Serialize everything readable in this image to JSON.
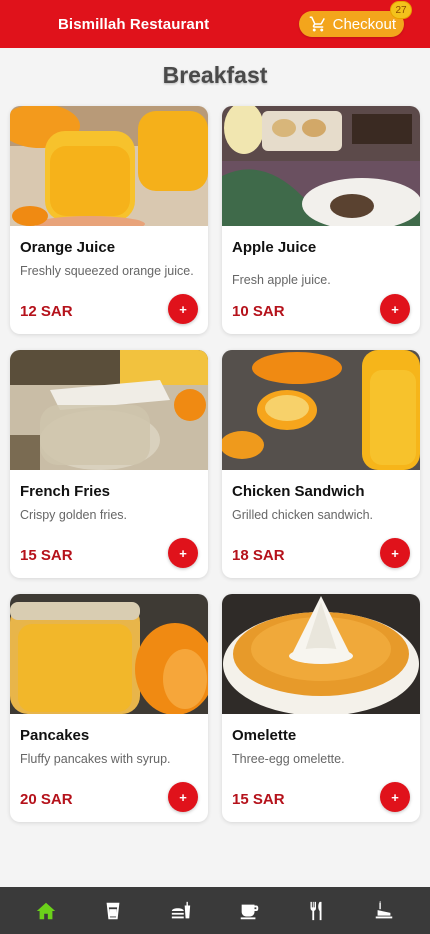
{
  "header": {
    "title": "Bismillah Restaurant",
    "checkout_label": "Checkout",
    "cart_count": "27"
  },
  "section_title": "Breakfast",
  "items": [
    {
      "name": "Orange Juice",
      "description": "Freshly squeezed orange juice.",
      "price": "12 SAR",
      "add_label": "+"
    },
    {
      "name": "Apple Juice",
      "description": "Fresh apple juice.",
      "price": "10 SAR",
      "add_label": "+"
    },
    {
      "name": "French Fries",
      "description": "Crispy golden fries.",
      "price": "15 SAR",
      "add_label": "+"
    },
    {
      "name": "Chicken Sandwich",
      "description": "Grilled chicken sandwich.",
      "price": "18 SAR",
      "add_label": "+"
    },
    {
      "name": "Pancakes",
      "description": "Fluffy pancakes with syrup.",
      "price": "20 SAR",
      "add_label": "+"
    },
    {
      "name": "Omelette",
      "description": "Three-egg omelette.",
      "price": "15 SAR",
      "add_label": "+"
    }
  ],
  "bottom_nav": [
    {
      "icon": "home-icon",
      "active": true
    },
    {
      "icon": "cup-icon",
      "active": false
    },
    {
      "icon": "burger-drink-icon",
      "active": false
    },
    {
      "icon": "coffee-icon",
      "active": false
    },
    {
      "icon": "fork-knife-icon",
      "active": false
    },
    {
      "icon": "dessert-icon",
      "active": false
    }
  ],
  "colors": {
    "header": "#e0121b",
    "checkout": "#f3a51c",
    "price": "#b5121b",
    "nav_bg": "#3a3a3a",
    "nav_active": "#6bd11a"
  }
}
